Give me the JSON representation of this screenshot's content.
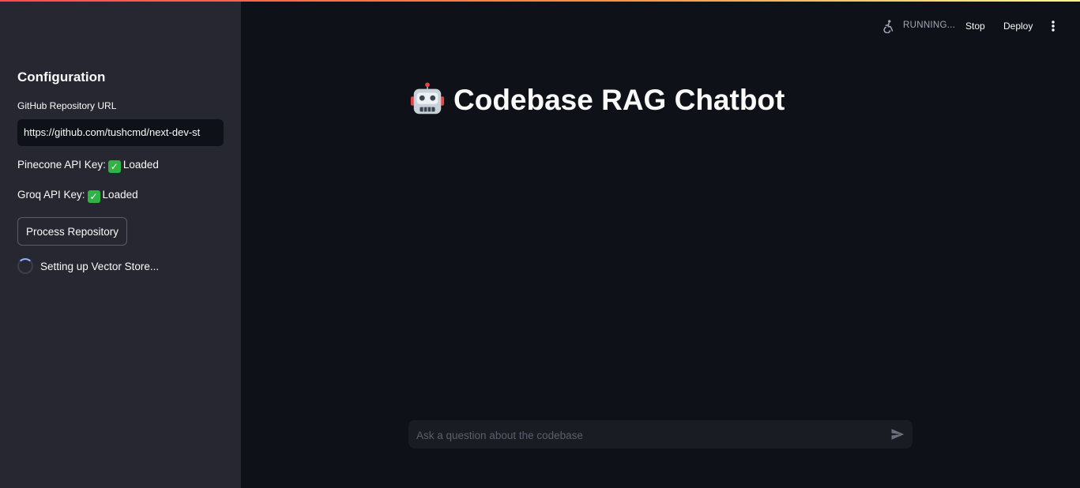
{
  "sidebar": {
    "title": "Configuration",
    "repo_label": "GitHub Repository URL",
    "repo_value": "https://github.com/tushcmd/next-dev-st",
    "pinecone_label": "Pinecone API Key:",
    "pinecone_status": "Loaded",
    "groq_label": "Groq API Key:",
    "groq_status": "Loaded",
    "process_button": "Process Repository",
    "spinner_text": "Setting up Vector Store..."
  },
  "header": {
    "running_text": "RUNNING...",
    "stop_label": "Stop",
    "deploy_label": "Deploy",
    "running_icon": "running-person-icon",
    "menu_icon": "vertical-dots-icon"
  },
  "main": {
    "title": "Codebase RAG Chatbot",
    "title_icon": "robot-icon"
  },
  "chat": {
    "placeholder": "Ask a question about the codebase",
    "send_icon": "send-icon"
  },
  "colors": {
    "background": "#0e1117",
    "sidebar": "#262730",
    "check": "#2fb344",
    "spinner_accent": "#8fb3ff"
  }
}
